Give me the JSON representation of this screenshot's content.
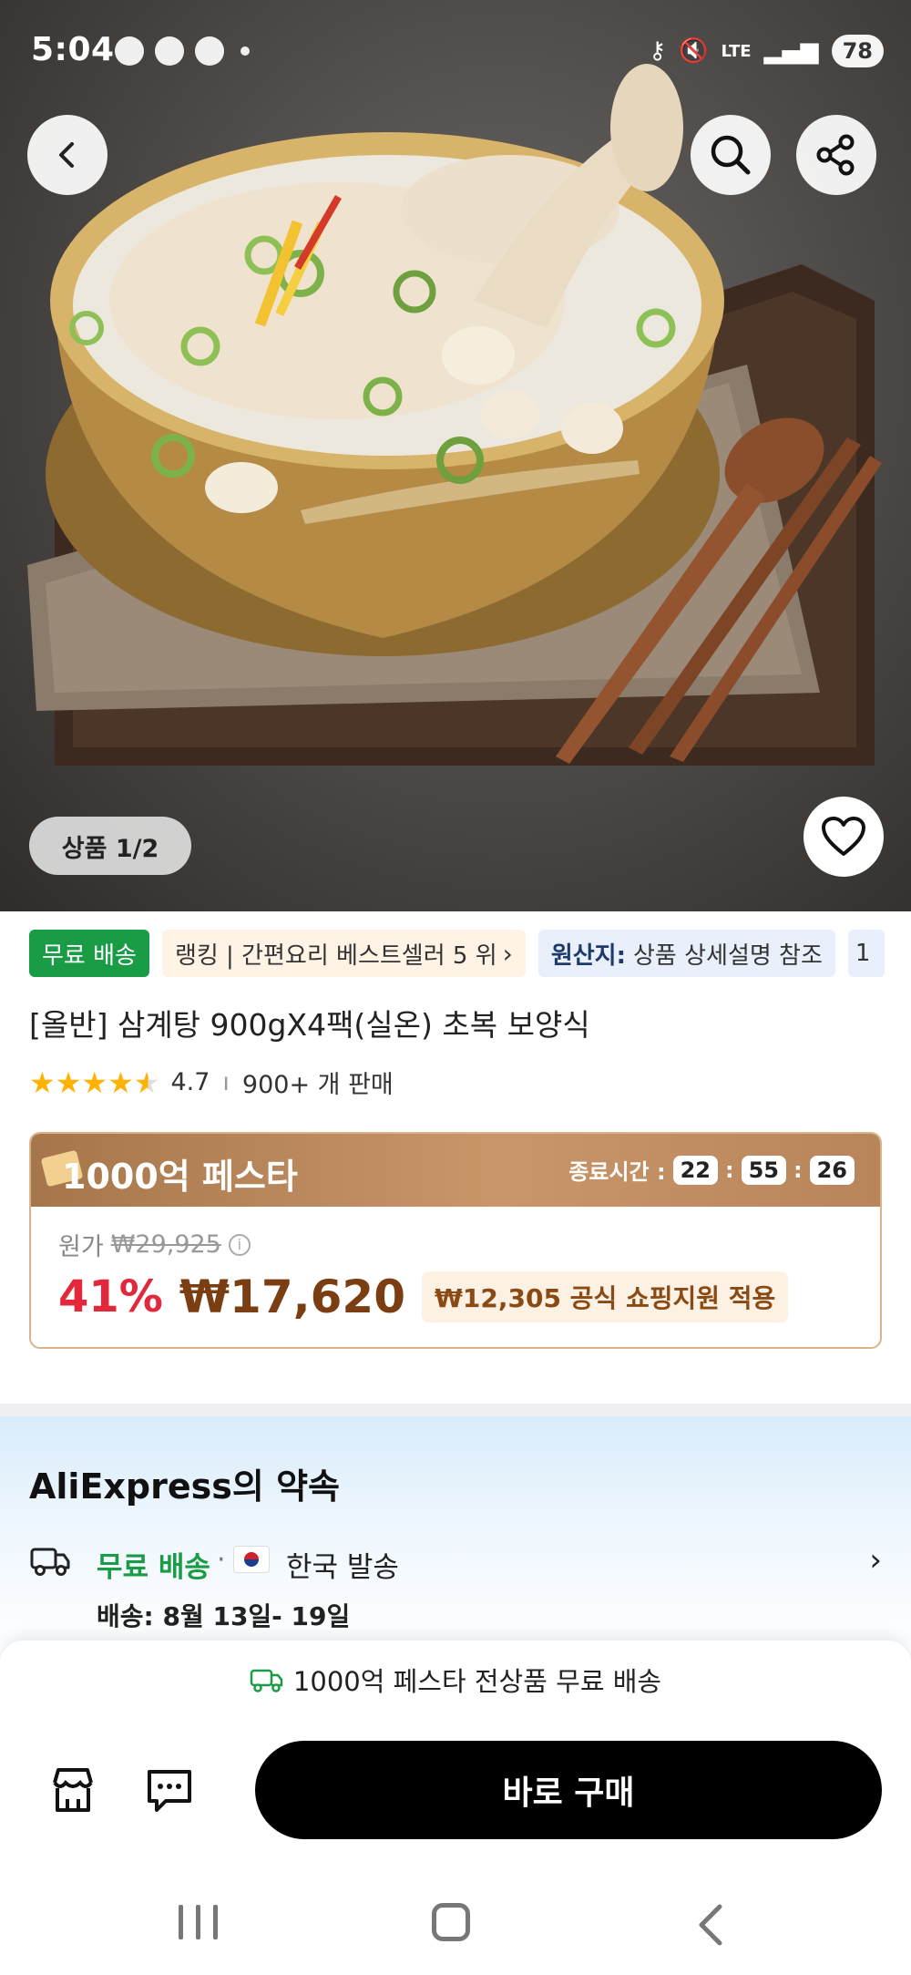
{
  "status_bar": {
    "time": "5:04",
    "network": "LTE",
    "battery": "78"
  },
  "gallery": {
    "counter": "상품 1/2"
  },
  "tags": {
    "free_shipping": "무료 배송",
    "ranking": "랭킹 | 간편요리 베스트셀러 5 위",
    "origin_label": "원산지:",
    "origin_value": "상품 상세설명 참조",
    "more": "1"
  },
  "product": {
    "title": "[올반] 삼계탕 900gX4팩(실온) 초복 보양식",
    "rating": "4.7",
    "sold": "900+ 개 판매"
  },
  "deal": {
    "festa_title": "1000억 페스타",
    "timer_label": "종료시간 :",
    "timer_hours": "22",
    "timer_minutes": "55",
    "timer_seconds": "26",
    "original_label": "원가",
    "original_price": "₩29,925",
    "discount": "41%",
    "price": "₩17,620",
    "subsidy": "₩12,305 공식 쇼핑지원 적용"
  },
  "promise": {
    "title": "AliExpress의 약속",
    "free_shipping": "무료 배송",
    "separator": "·",
    "ship_from": "한국 발송",
    "delivery": "배송: 8월 13일- 19일"
  },
  "bottom": {
    "free_banner": "1000억 페스타 전상품 무료 배송",
    "buy_now": "바로 구매"
  },
  "colors": {
    "free_green": "#1a9b46",
    "discount_red": "#e3283b",
    "price_brown": "#7b3d12",
    "buy_button": "#000000"
  }
}
